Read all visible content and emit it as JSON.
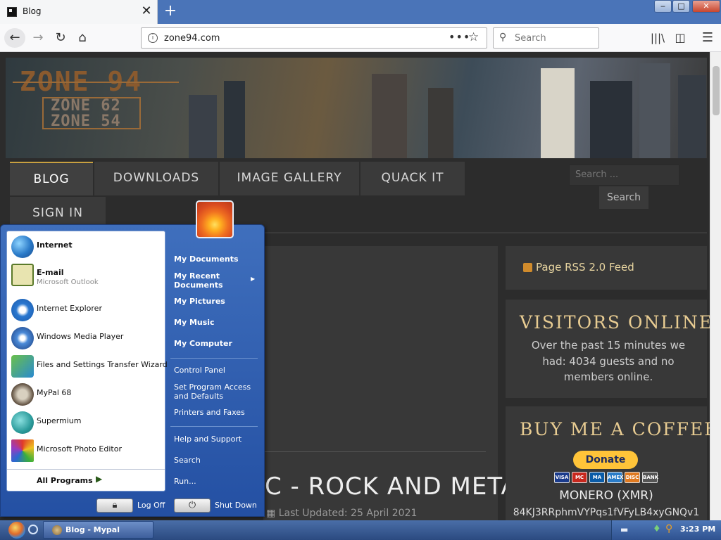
{
  "browser": {
    "tab_title": "Blog",
    "url": "zone94.com",
    "search_placeholder": "Search",
    "window_buttons": {
      "min": "‒",
      "max": "□",
      "close": "✕"
    }
  },
  "site": {
    "logo_main": "ZONE 94",
    "logo_sub1": "ZONE 62",
    "logo_sub2": "ZONE 54",
    "menu": [
      "BLOG",
      "DOWNLOADS",
      "IMAGE GALLERY",
      "QUACK IT",
      "SIGN IN"
    ],
    "search_placeholder": "Search ...",
    "search_button": "Search",
    "article_title": "C - ROCK AND METAL",
    "article_updated": "Last Updated: 25 April 2021",
    "rss_link": "Page RSS 2.0 Feed",
    "visitors_heading": "VISITORS ONLINE",
    "visitors_text": "Over the past 15 minutes we had: 4034 guests and no members online.",
    "coffee_heading": "BUY ME A COFFEE",
    "donate_label": "Donate",
    "cards": [
      "VISA",
      "MC",
      "MA",
      "AMEX",
      "DISC",
      "BANK"
    ],
    "monero_label": "MONERO (XMR)",
    "monero_address": "84KJ3RRphmVYPqs1fVFyLB4xyGNQv1"
  },
  "start_menu": {
    "left_items": [
      {
        "label": "Internet",
        "sub": "",
        "bold": true,
        "icon": "globe-icon"
      },
      {
        "label": "E-mail",
        "sub": "Microsoft Outlook",
        "bold": true,
        "icon": "email-icon"
      },
      {
        "label": "Internet Explorer",
        "sub": "",
        "bold": false,
        "icon": "ie-icon"
      },
      {
        "label": "Windows Media Player",
        "sub": "",
        "bold": false,
        "icon": "media-player-icon"
      },
      {
        "label": "Files and Settings Transfer Wizard",
        "sub": "",
        "bold": false,
        "icon": "transfer-wizard-icon"
      },
      {
        "label": "MyPal 68",
        "sub": "",
        "bold": false,
        "icon": "mypal-icon"
      },
      {
        "label": "Supermium",
        "sub": "",
        "bold": false,
        "icon": "supermium-icon"
      },
      {
        "label": "Microsoft Photo Editor",
        "sub": "",
        "bold": false,
        "icon": "photo-editor-icon"
      }
    ],
    "all_programs": "All Programs",
    "right_items": [
      "My Documents",
      "My Recent Documents",
      "My Pictures",
      "My Music",
      "My Computer",
      "Control Panel",
      "Set Program Access and Defaults",
      "Printers and Faxes",
      "Help and Support",
      "Search",
      "Run..."
    ],
    "log_off": "Log Off",
    "shut_down": "Shut Down"
  },
  "taskbar": {
    "task_label": "Blog - Mypal",
    "clock": "3:23 PM"
  }
}
